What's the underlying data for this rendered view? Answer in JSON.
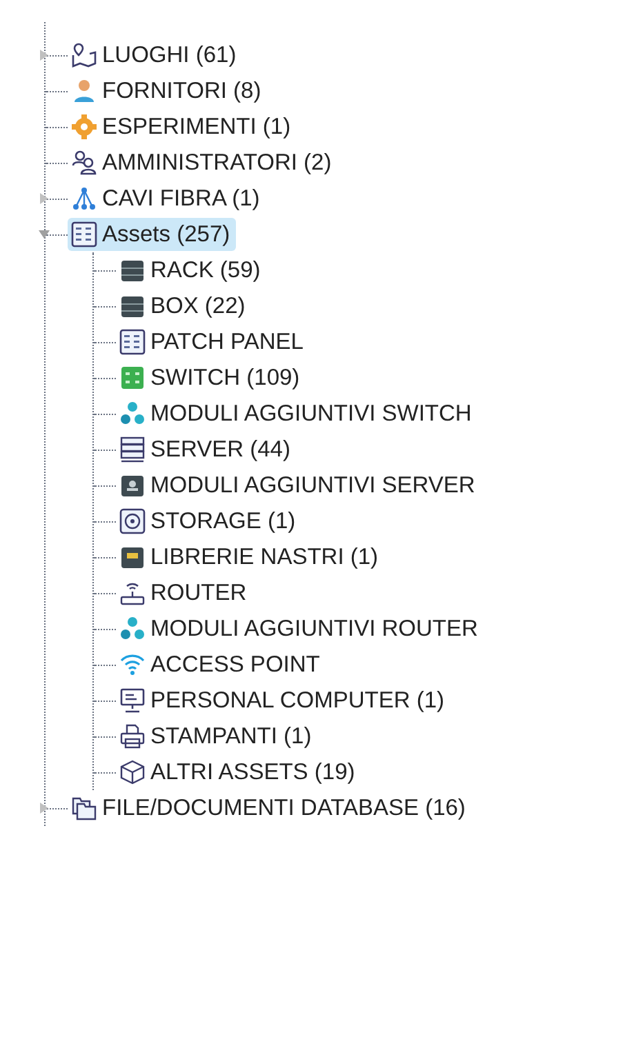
{
  "tree": [
    {
      "label": "LUOGHI (61)",
      "kind": "map",
      "expanded": false,
      "selected": false
    },
    {
      "label": "FORNITORI (8)",
      "kind": "person",
      "selected": false
    },
    {
      "label": "ESPERIMENTI (1)",
      "kind": "gear",
      "selected": false
    },
    {
      "label": "AMMINISTRATORI (2)",
      "kind": "people",
      "selected": false
    },
    {
      "label": "CAVI FIBRA (1)",
      "kind": "hierarchy",
      "expanded": false,
      "selected": false
    },
    {
      "label": "Assets (257)",
      "kind": "grid",
      "expanded": true,
      "selected": true,
      "children": [
        {
          "label": "RACK (59)",
          "kind": "rack",
          "selected": false
        },
        {
          "label": "BOX (22)",
          "kind": "rack",
          "selected": false
        },
        {
          "label": "PATCH PANEL",
          "kind": "grid",
          "selected": false
        },
        {
          "label": "SWITCH (109)",
          "kind": "switch",
          "selected": false
        },
        {
          "label": "MODULI AGGIUNTIVI SWITCH",
          "kind": "dots",
          "selected": false
        },
        {
          "label": "SERVER (44)",
          "kind": "server",
          "selected": false
        },
        {
          "label": "MODULI AGGIUNTIVI SERVER",
          "kind": "module",
          "selected": false
        },
        {
          "label": "STORAGE (1)",
          "kind": "disk",
          "selected": false
        },
        {
          "label": "LIBRERIE NASTRI (1)",
          "kind": "tape",
          "selected": false
        },
        {
          "label": "ROUTER",
          "kind": "router",
          "selected": false
        },
        {
          "label": "MODULI AGGIUNTIVI ROUTER",
          "kind": "dots",
          "selected": false
        },
        {
          "label": "ACCESS POINT",
          "kind": "wifi",
          "selected": false
        },
        {
          "label": "PERSONAL COMPUTER (1)",
          "kind": "computer",
          "selected": false
        },
        {
          "label": "STAMPANTI (1)",
          "kind": "printer",
          "selected": false
        },
        {
          "label": "ALTRI ASSETS (19)",
          "kind": "cube",
          "selected": false
        }
      ]
    },
    {
      "label": "FILE/DOCUMENTI DATABASE (16)",
      "kind": "folder",
      "expanded": false,
      "selected": false
    }
  ]
}
